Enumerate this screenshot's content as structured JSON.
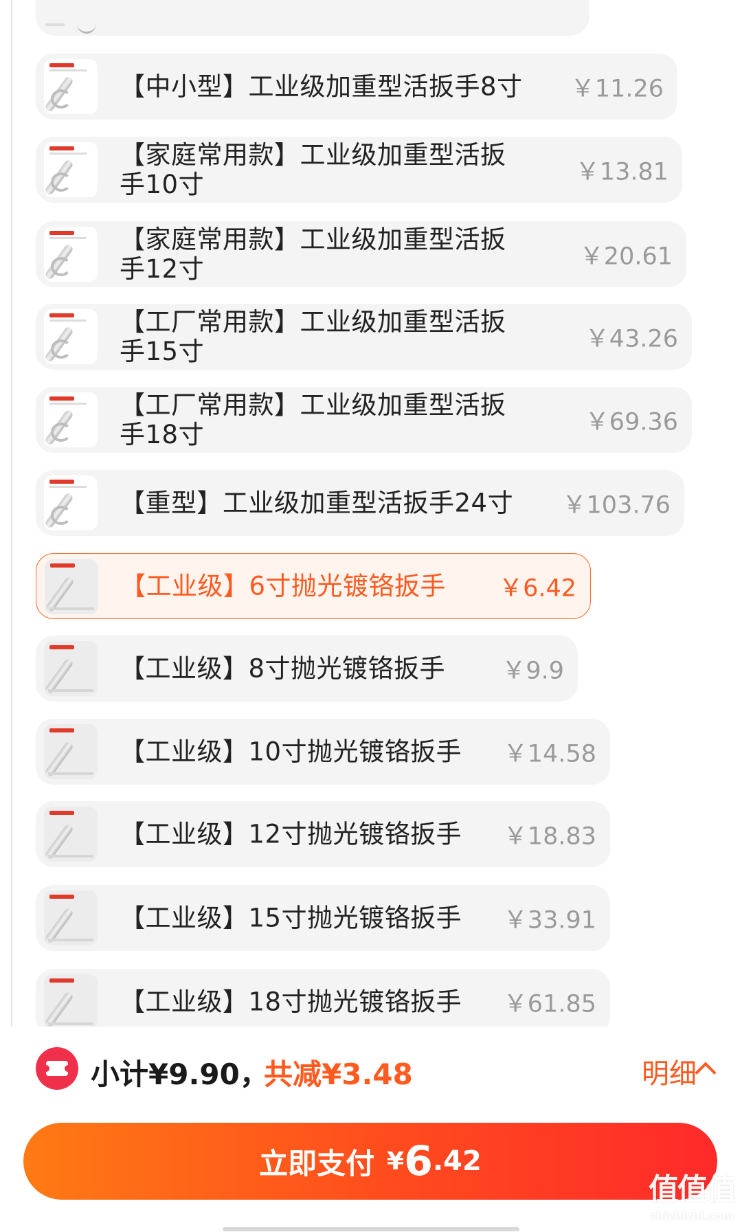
{
  "products": [
    {
      "name": "【中小型】工业级加重型活扳手8寸",
      "price": "￥11.26",
      "selected": false
    },
    {
      "name": "【家庭常用款】工业级加重型活扳\n手10寸",
      "price": "￥13.81",
      "selected": false
    },
    {
      "name": "【家庭常用款】工业级加重型活扳\n手12寸",
      "price": "￥20.61",
      "selected": false
    },
    {
      "name": "【工厂常用款】工业级加重型活扳\n手15寸",
      "price": "￥43.26",
      "selected": false
    },
    {
      "name": "【工厂常用款】工业级加重型活扳\n手18寸",
      "price": "￥69.36",
      "selected": false
    },
    {
      "name": "【重型】工业级加重型活扳手24寸",
      "price": "￥103.76",
      "selected": false
    },
    {
      "name": "【工业级】6寸抛光镀铬扳手",
      "price": "￥6.42",
      "selected": true
    },
    {
      "name": "【工业级】8寸抛光镀铬扳手",
      "price": "￥9.9",
      "selected": false
    },
    {
      "name": "【工业级】10寸抛光镀铬扳手",
      "price": "￥14.58",
      "selected": false
    },
    {
      "name": "【工业级】12寸抛光镀铬扳手",
      "price": "￥18.83",
      "selected": false
    },
    {
      "name": "【工业级】15寸抛光镀铬扳手",
      "price": "￥33.91",
      "selected": false
    },
    {
      "name": "【工业级】18寸抛光镀铬扳手",
      "price": "￥61.85",
      "selected": false
    }
  ],
  "summary": {
    "subtotal": "小计¥9.90，",
    "discount": "共减¥3.48",
    "detail": "明细"
  },
  "pay": {
    "label": "立即支付",
    "currency": "¥",
    "amount_int": "6",
    "amount_dec": ".42"
  },
  "watermark": {
    "main": "值值值",
    "sub": "zhizhizhi.com"
  },
  "colors": {
    "accent": "#ff5a1f",
    "selected_border": "#ff6a2c",
    "card_bg": "#f4f4f4",
    "price_grey": "#9a9a9a",
    "badge_red": "#f0304a"
  }
}
